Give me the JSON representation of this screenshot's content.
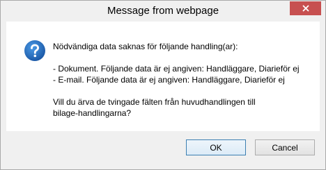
{
  "dialog": {
    "title": "Message from webpage",
    "icon": "question-icon",
    "message": {
      "line1": "Nödvändiga data saknas för följande handling(ar):",
      "line2": "- Dokument. Följande data är ej angiven: Handläggare, Diarieför ej",
      "line3": "- E-mail. Följande data är ej angiven: Handläggare, Diarieför ej",
      "line4": "Vill du ärva de tvingade fälten från huvudhandlingen till",
      "line5": "bilage-handlingarna?"
    },
    "buttons": {
      "ok": "OK",
      "cancel": "Cancel"
    }
  },
  "colors": {
    "close_button": "#c75050",
    "dialog_background": "#f0f0f0",
    "icon_blue": "#2c6fbe"
  }
}
